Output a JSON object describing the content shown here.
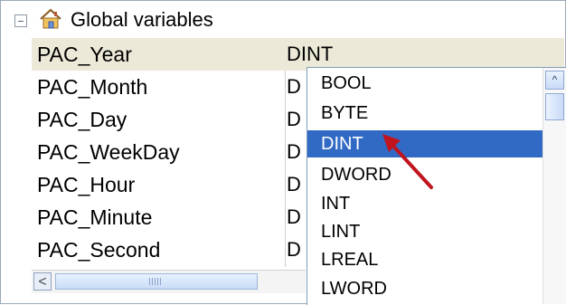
{
  "tree": {
    "expander_symbol": "⊟",
    "title": "Global variables",
    "icon": "home-icon"
  },
  "rows": [
    {
      "name": "PAC_Year",
      "type": "DINT",
      "selected": true
    },
    {
      "name": "PAC_Month",
      "type": "D"
    },
    {
      "name": "PAC_Day",
      "type": "D"
    },
    {
      "name": "PAC_WeekDay",
      "type": "D"
    },
    {
      "name": "PAC_Hour",
      "type": "D"
    },
    {
      "name": "PAC_Minute",
      "type": "D"
    },
    {
      "name": "PAC_Second",
      "type": "D"
    }
  ],
  "dropdown": {
    "options": [
      "BOOL",
      "BYTE",
      "DINT",
      "DWORD",
      "INT",
      "LINT",
      "LREAL",
      "LWORD"
    ],
    "selected": "DINT"
  },
  "scrollbar": {
    "left_arrow": "<",
    "up_arrow": "^"
  },
  "colors": {
    "selection": "#316ac5",
    "row_selected_bg": "#ece9d8",
    "annotation_arrow": "#c0141e"
  }
}
